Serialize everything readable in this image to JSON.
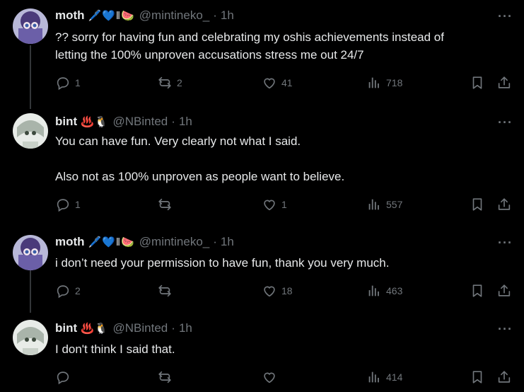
{
  "tweets": [
    {
      "name": "moth",
      "emojis": "🖊️💙‖🍉",
      "handle": "@mintineko_",
      "time": "1h",
      "lines": [
        "?? sorry for having fun and celebrating my oshis achievements instead of",
        "letting the 100% unproven accusations stress me out 24/7"
      ],
      "replies": "1",
      "reposts": "2",
      "likes": "41",
      "views": "718"
    },
    {
      "name": "bint",
      "emojis": "♨️🐧",
      "handle": "@NBinted",
      "time": "1h",
      "lines": [
        "You can have fun. Very clearly not what I said.",
        "",
        "Also not as 100% unproven as people want to believe."
      ],
      "replies": "1",
      "reposts": "",
      "likes": "1",
      "views": "557"
    },
    {
      "name": "moth",
      "emojis": "🖊️💙‖🍉",
      "handle": "@mintineko_",
      "time": "1h",
      "lines": [
        "i don’t need your permission to have fun, thank you very much."
      ],
      "replies": "2",
      "reposts": "",
      "likes": "18",
      "views": "463"
    },
    {
      "name": "bint",
      "emojis": "♨️🐧",
      "handle": "@NBinted",
      "time": "1h",
      "lines": [
        "I don't think I said that."
      ],
      "replies": "",
      "reposts": "",
      "likes": "",
      "views": "414"
    }
  ],
  "ui": {
    "dot": "·",
    "more": "···"
  },
  "colors": {
    "background": "#000000",
    "text": "#e7e9ea",
    "muted": "#71767b",
    "thread_line": "#333639"
  },
  "icons": [
    "reply-icon",
    "repost-icon",
    "like-icon",
    "views-icon",
    "bookmark-icon",
    "share-icon",
    "more-icon"
  ]
}
